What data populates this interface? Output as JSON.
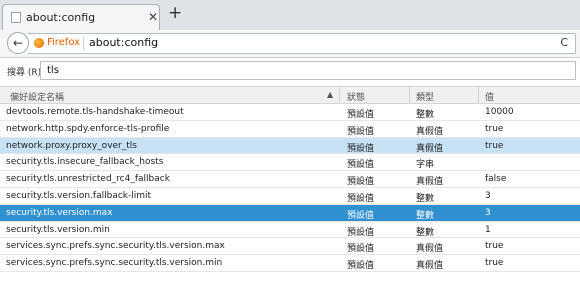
{
  "tab": {
    "title": "about:config",
    "close_glyph": "✕",
    "new_tab_glyph": "+"
  },
  "nav": {
    "back_glyph": "←",
    "identity_label": "Firefox",
    "url": "about:config",
    "reload_glyph": "C"
  },
  "search": {
    "label": "搜尋 (R):",
    "value": "tls"
  },
  "table": {
    "headers": {
      "name": "偏好設定名稱",
      "status": "狀態",
      "type": "類型",
      "value": "值"
    },
    "sort_glyph": "▲",
    "rows": [
      {
        "name": "devtools.remote.tls-handshake-timeout",
        "status": "預設值",
        "type": "整數",
        "value": "10000",
        "highlight": "none"
      },
      {
        "name": "network.http.spdy.enforce-tls-profile",
        "status": "預設值",
        "type": "真假值",
        "value": "true",
        "highlight": "none"
      },
      {
        "name": "network.proxy.proxy_over_tls",
        "status": "預設值",
        "type": "真假值",
        "value": "true",
        "highlight": "light"
      },
      {
        "name": "security.tls.insecure_fallback_hosts",
        "status": "預設值",
        "type": "字串",
        "value": "",
        "highlight": "none"
      },
      {
        "name": "security.tls.unrestricted_rc4_fallback",
        "status": "預設值",
        "type": "真假值",
        "value": "false",
        "highlight": "none"
      },
      {
        "name": "security.tls.version.fallback-limit",
        "status": "預設值",
        "type": "整數",
        "value": "3",
        "highlight": "none"
      },
      {
        "name": "security.tls.version.max",
        "status": "預設值",
        "type": "整數",
        "value": "3",
        "highlight": "dark"
      },
      {
        "name": "security.tls.version.min",
        "status": "預設值",
        "type": "整數",
        "value": "1",
        "highlight": "none"
      },
      {
        "name": "services.sync.prefs.sync.security.tls.version.max",
        "status": "預設值",
        "type": "真假值",
        "value": "true",
        "highlight": "none"
      },
      {
        "name": "services.sync.prefs.sync.security.tls.version.min",
        "status": "預設值",
        "type": "真假值",
        "value": "true",
        "highlight": "none"
      }
    ]
  }
}
